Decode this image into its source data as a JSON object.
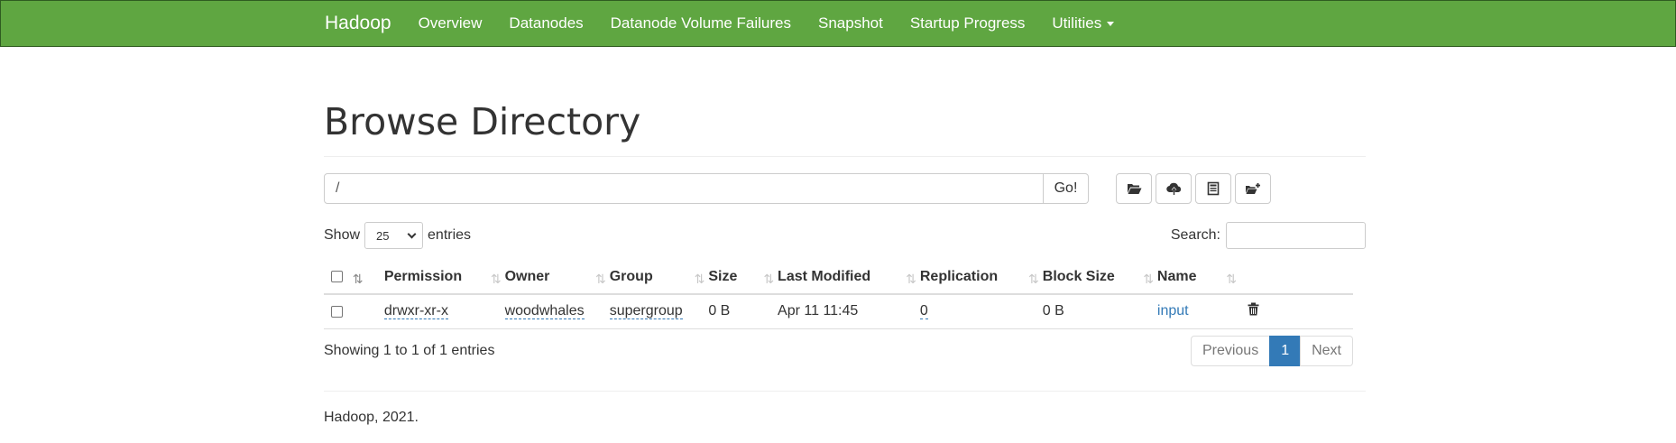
{
  "navbar": {
    "brand": "Hadoop",
    "items": [
      "Overview",
      "Datanodes",
      "Datanode Volume Failures",
      "Snapshot",
      "Startup Progress",
      "Utilities"
    ],
    "color": "#5fa641"
  },
  "page": {
    "title": "Browse Directory"
  },
  "path": {
    "value": "/",
    "go_label": "Go!"
  },
  "toolbar": {
    "icons": [
      "open-folder-icon",
      "upload-icon",
      "cut-paste-icon",
      "create-folder-icon"
    ]
  },
  "length": {
    "show_label": "Show",
    "value": "25",
    "entries_label": "entries"
  },
  "search": {
    "label": "Search:",
    "value": ""
  },
  "table": {
    "headers": [
      "Permission",
      "Owner",
      "Group",
      "Size",
      "Last Modified",
      "Replication",
      "Block Size",
      "Name"
    ],
    "rows": [
      {
        "permission": "drwxr-xr-x",
        "owner": "woodwhales",
        "group": "supergroup",
        "size": "0 B",
        "last_modified": "Apr 11 11:45",
        "replication": "0",
        "block_size": "0 B",
        "name": "input"
      }
    ]
  },
  "info": {
    "text": "Showing 1 to 1 of 1 entries"
  },
  "pagination": {
    "previous": "Previous",
    "current": "1",
    "next": "Next"
  },
  "footer": {
    "text": "Hadoop, 2021."
  }
}
